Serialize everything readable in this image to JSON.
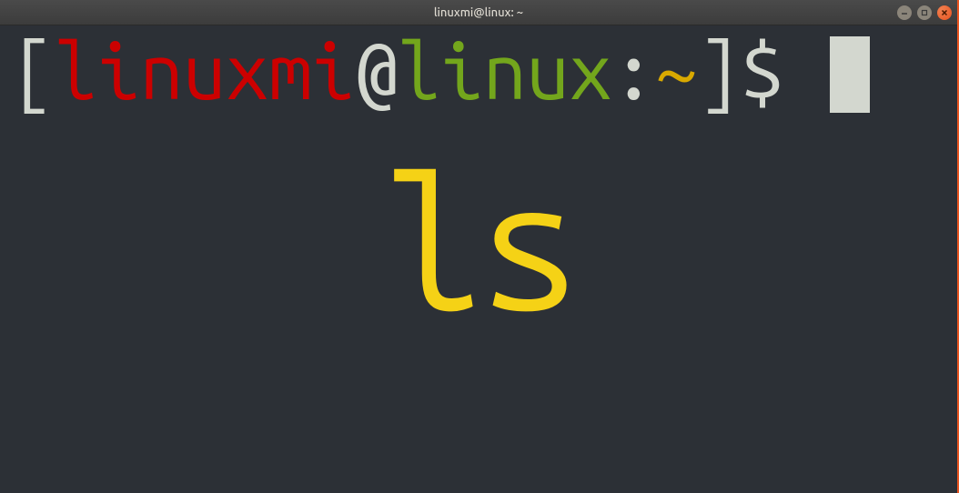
{
  "window": {
    "title": "linuxmi@linux: ~"
  },
  "prompt": {
    "open_bracket": "[",
    "user": "linuxmi",
    "at": "@",
    "host": "linux",
    "colon": ":",
    "path": "~",
    "close_bracket": "]",
    "symbol": "$"
  },
  "overlay": {
    "command": "ls"
  },
  "colors": {
    "user": "#cc0000",
    "host": "#73a61c",
    "path": "#d9a900",
    "text": "#d3d7cf",
    "overlay": "#f5d216",
    "close_btn": "#e95420"
  }
}
